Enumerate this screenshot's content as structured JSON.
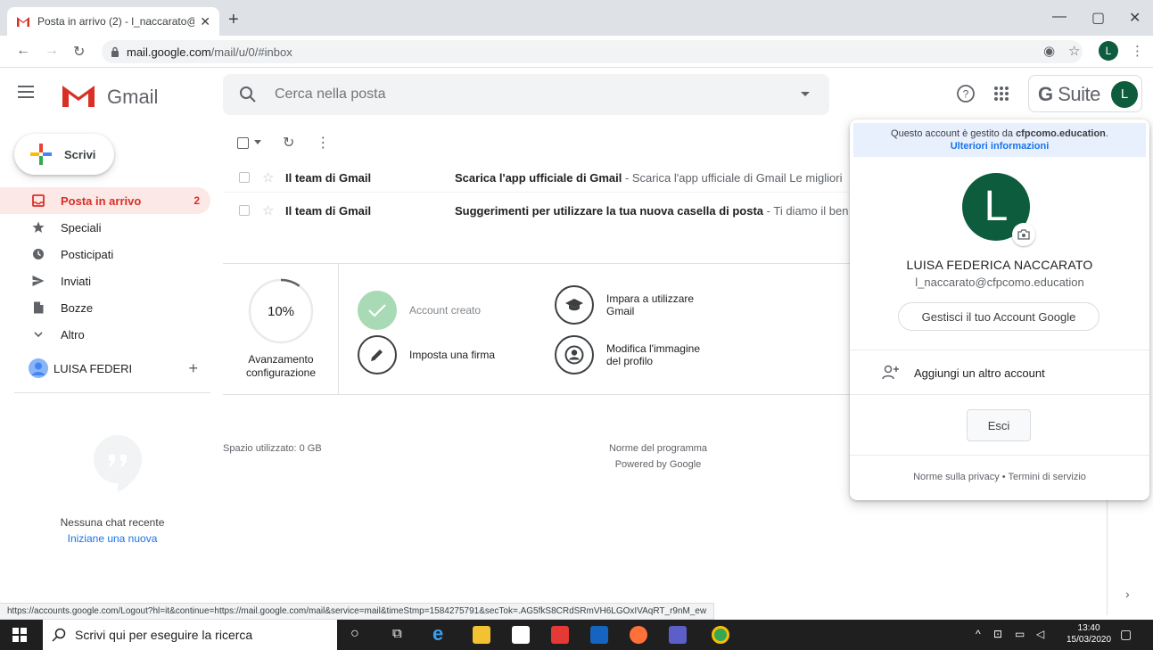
{
  "browser": {
    "tab_title": "Posta in arrivo (2) - l_naccarato@",
    "url_host": "mail.google.com",
    "url_path": "/mail/u/0/#inbox",
    "profile_initial": "L"
  },
  "gmail": {
    "logo_text": "Gmail",
    "search_placeholder": "Cerca nella posta",
    "gsuite_g": "G",
    "gsuite_suite": " Suite",
    "avatar_initial": "L"
  },
  "sidebar": {
    "compose_label": "Scrivi",
    "items": [
      {
        "label": "Posta in arrivo",
        "count": "2"
      },
      {
        "label": "Speciali"
      },
      {
        "label": "Posticipati"
      },
      {
        "label": "Inviati"
      },
      {
        "label": "Bozze"
      },
      {
        "label": "Altro"
      }
    ],
    "hangouts_user": "LUISA FEDERI",
    "no_chat": "Nessuna chat recente",
    "start_new": "Iniziane una nuova"
  },
  "mails": [
    {
      "sender": "Il team di Gmail",
      "subject": "Scarica l'app ufficiale di Gmail",
      "snippet": " - Scarica l'app ufficiale di Gmail Le migliori"
    },
    {
      "sender": "Il team di Gmail",
      "subject": "Suggerimenti per utilizzare la tua nuova casella di posta",
      "snippet": " - Ti diamo il ben"
    }
  ],
  "setup": {
    "percent": "10%",
    "progress": 0.1,
    "label_line1": "Avanzamento",
    "label_line2": "configurazione",
    "tasks": {
      "account_created": "Account creato",
      "learn_line1": "Impara a utilizzare",
      "learn_line2": "Gmail",
      "signature": "Imposta una firma",
      "photo_line1": "Modifica l'immagine",
      "photo_line2": "del profilo"
    }
  },
  "footer": {
    "storage": "Spazio utilizzato: 0 GB",
    "terms": "Norme del programma",
    "powered": "Powered by Google"
  },
  "account_popup": {
    "managed_prefix": "Questo account è gestito da ",
    "managed_domain": "cfpcomo.education",
    "managed_suffix": ".",
    "more_info": "Ulteriori informazioni",
    "initial": "L",
    "name": "LUISA FEDERICA NACCARATO",
    "email": "l_naccarato@cfpcomo.education",
    "manage_button": "Gestisci il tuo Account Google",
    "add_account": "Aggiungi un altro account",
    "logout": "Esci",
    "privacy": "Norme sulla privacy",
    "separator": " • ",
    "tos": "Termini di servizio"
  },
  "status_url": "https://accounts.google.com/Logout?hl=it&continue=https://mail.google.com/mail&service=mail&timeStmp=1584275791&secTok=.AG5fkS8CRdSRmVH6LGOxIVAqRT_r9nM_ew",
  "taskbar": {
    "search_placeholder": "Scrivi qui per eseguire la ricerca",
    "time": "13:40",
    "date": "15/03/2020"
  },
  "colors": {
    "gmail_red": "#d93025",
    "avatar_green": "#0d5c3d",
    "link_blue": "#1a73e8",
    "done_green": "#a8dab5"
  }
}
